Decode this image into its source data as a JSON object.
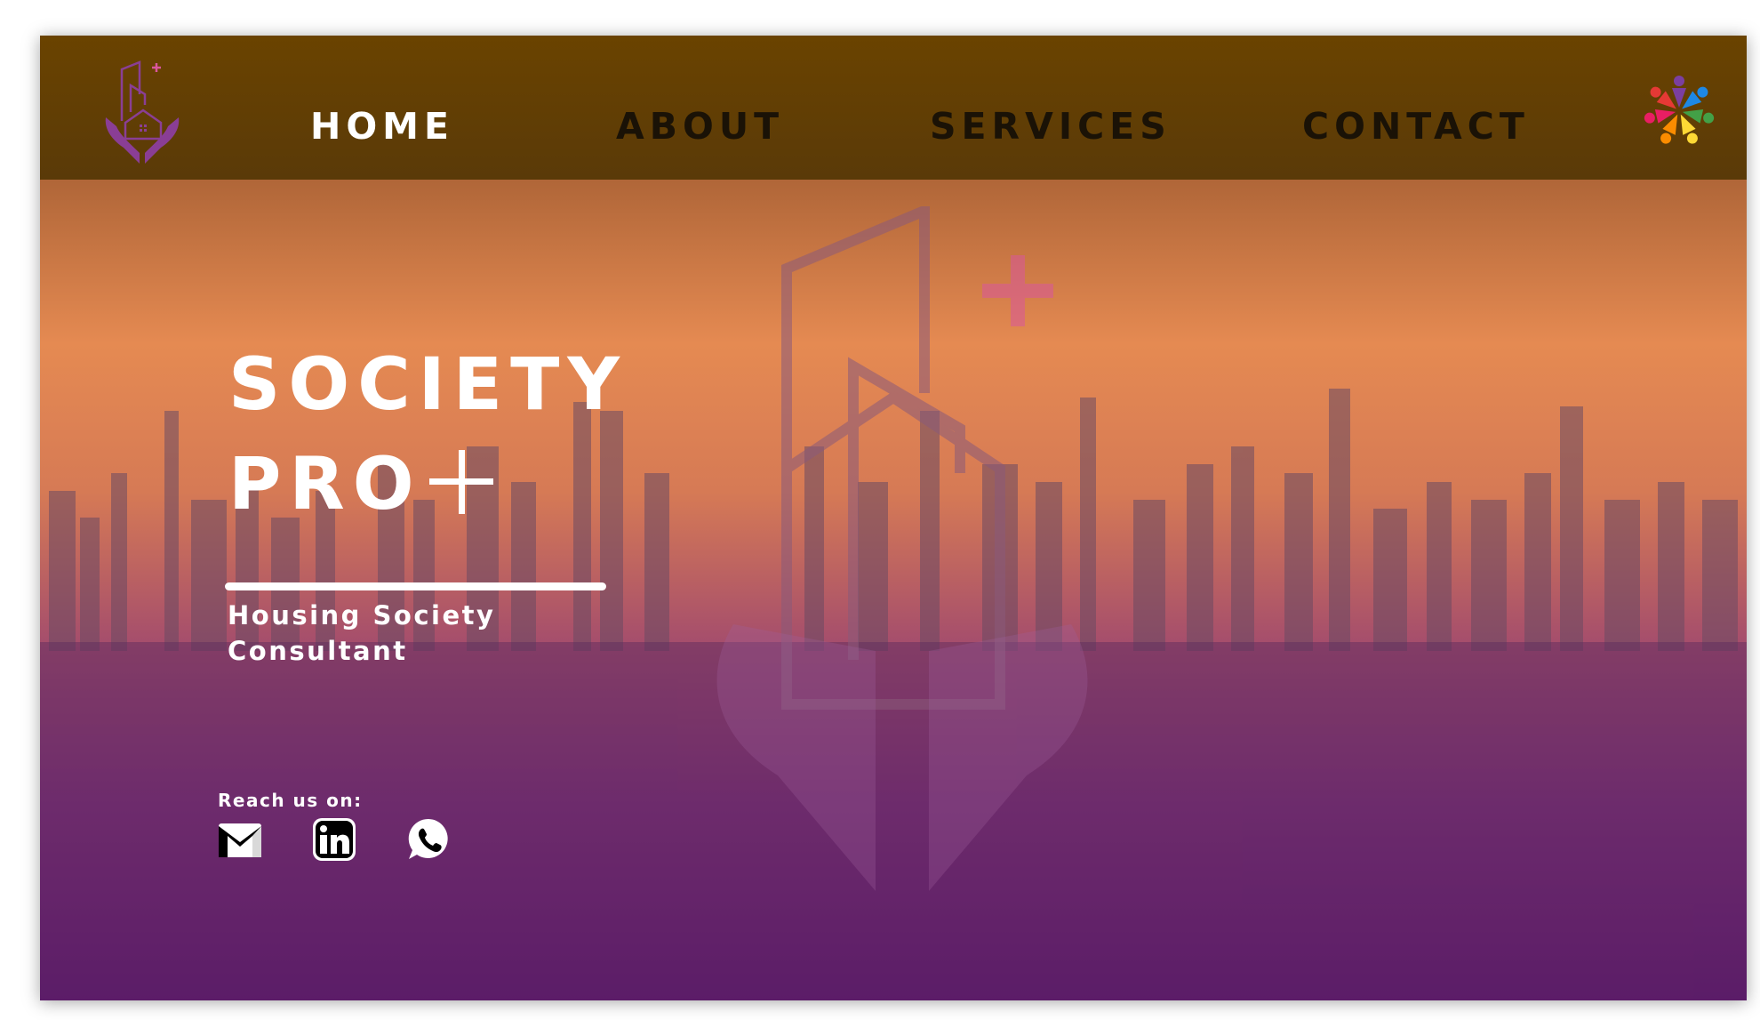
{
  "nav": {
    "items": [
      {
        "label": "HOME",
        "active": true
      },
      {
        "label": "ABOUT",
        "active": false
      },
      {
        "label": "SERVICES",
        "active": false
      },
      {
        "label": "CONTACT",
        "active": false
      }
    ]
  },
  "hero": {
    "title_line1": "SOCIETY",
    "title_line2": "PRO",
    "subtitle_line1": "Housing Society",
    "subtitle_line2": "Consultant"
  },
  "contact": {
    "reach_label": "Reach us on:",
    "icons": [
      "gmail-icon",
      "linkedin-icon",
      "whatsapp-icon"
    ]
  },
  "colors": {
    "header": "#6a4300",
    "accent_purple": "#8a3e95",
    "plus_pink": "#d9579c",
    "text_light": "#ffffff",
    "nav_text": "#1a1206"
  }
}
